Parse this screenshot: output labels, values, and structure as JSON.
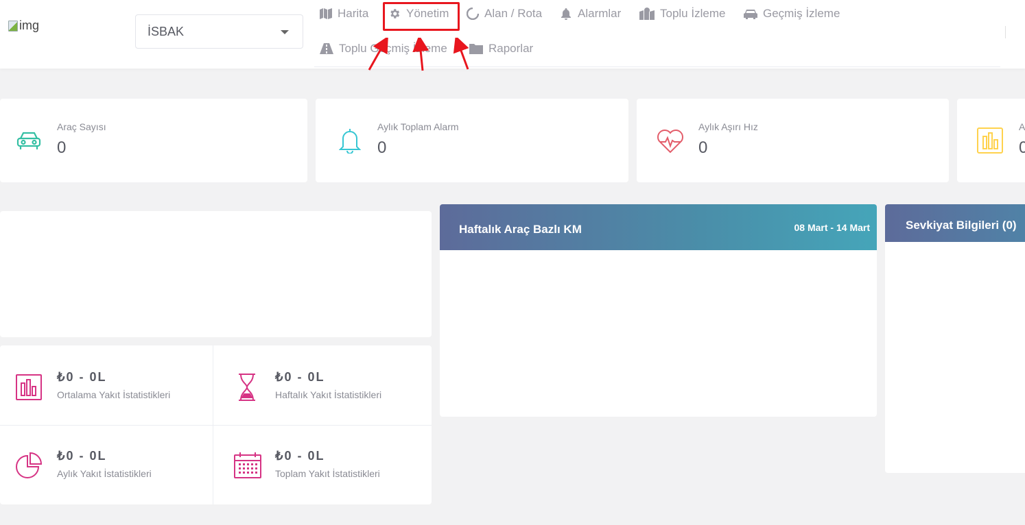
{
  "header": {
    "logo_alt": "img",
    "company_select": {
      "value": "İSBAK"
    }
  },
  "nav": {
    "items": [
      {
        "label": "Harita",
        "icon": "map-icon"
      },
      {
        "label": "Yönetim",
        "icon": "gear-icon"
      },
      {
        "label": "Alan / Rota",
        "icon": "circle-notch-icon"
      },
      {
        "label": "Alarmlar",
        "icon": "bell-icon"
      },
      {
        "label": "Toplu İzleme",
        "icon": "map-marked-icon"
      },
      {
        "label": "Geçmiş İzleme",
        "icon": "car-icon"
      },
      {
        "label": "Toplu Geçmiş İzleme",
        "icon": "road-icon"
      },
      {
        "label": "Raporlar",
        "icon": "folder-icon"
      }
    ]
  },
  "stats": [
    {
      "label": "Araç Sayısı",
      "value": "0",
      "icon": "car-icon",
      "color": "#34bfa3"
    },
    {
      "label": "Aylık Toplam Alarm",
      "value": "0",
      "icon": "bell-icon",
      "color": "#36a3f7"
    },
    {
      "label": "Aylık Aşırı Hız",
      "value": "0",
      "icon": "heartbeat-icon",
      "color": "#f4516c"
    },
    {
      "label": "A",
      "value": "0",
      "icon": "bar-chart-icon",
      "color": "#ffb822"
    }
  ],
  "fuel": [
    {
      "value": "₺0 - 0L",
      "label": "Ortalama Yakıt İstatistikleri",
      "icon": "bar-chart-icon"
    },
    {
      "value": "₺0 - 0L",
      "label": "Haftalık Yakıt İstatistikleri",
      "icon": "hourglass-icon"
    },
    {
      "value": "₺0 - 0L",
      "label": "Aylık Yakıt İstatistikleri",
      "icon": "pie-chart-icon"
    },
    {
      "value": "₺0 - 0L",
      "label": "Toplam Yakıt İstatistikleri",
      "icon": "calendar-icon"
    }
  ],
  "weekly_km": {
    "title": "Haftalık Araç Bazlı KM",
    "date_range": "08 Mart - 14 Mart"
  },
  "shipment": {
    "title": "Sevkiyat Bilgileri (0)"
  },
  "colors": {
    "fuel_icon": "#d63384",
    "highlight": "#e8161e",
    "header_gradient_start": "#5d6b9a",
    "header_gradient_end": "#45a5b9"
  }
}
